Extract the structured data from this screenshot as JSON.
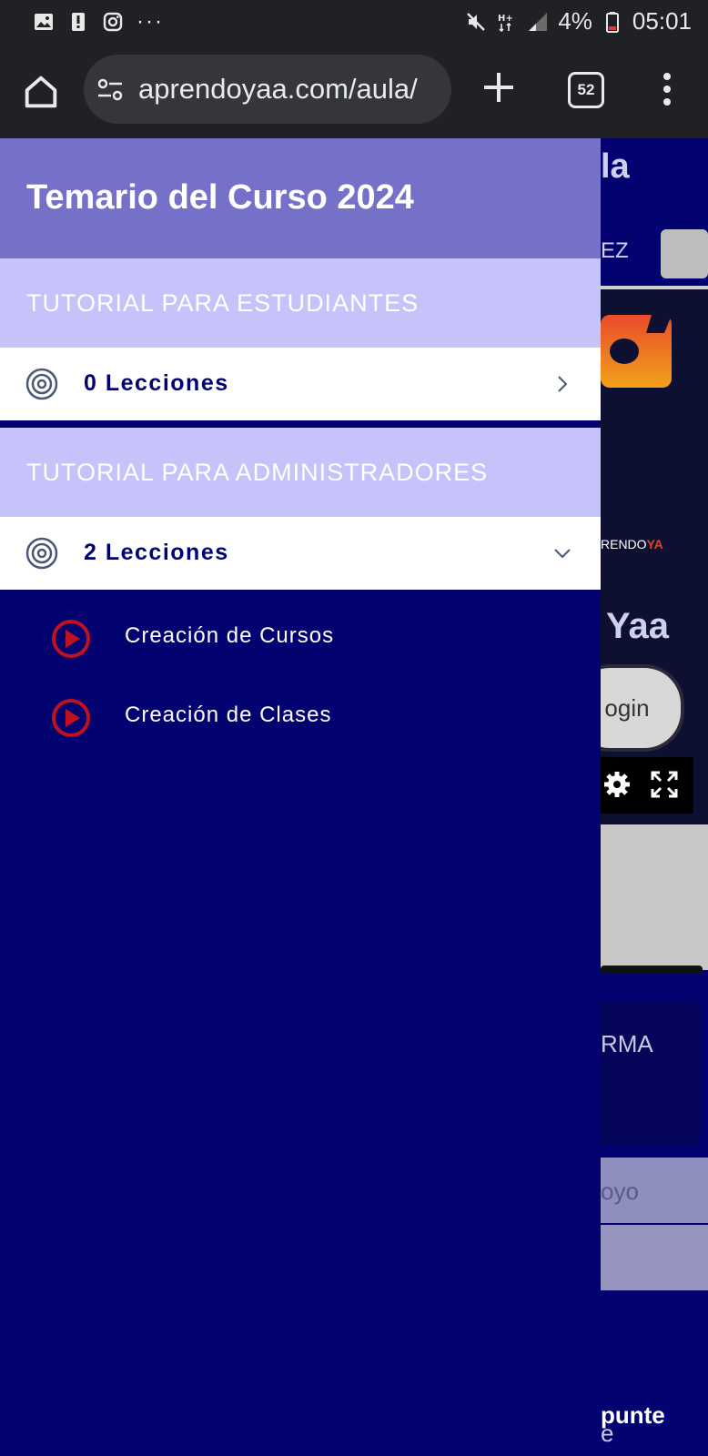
{
  "status_bar": {
    "battery": "4%",
    "time": "05:01",
    "more_dots": "···"
  },
  "browser": {
    "url": "aprendoyaa.com/aula/",
    "tab_count": "52"
  },
  "drawer": {
    "title": "Temario del Curso 2024",
    "sections": [
      {
        "heading": "TUTORIAL PARA ESTUDIANTES",
        "lessons_label": "0 Lecciones",
        "expanded": false,
        "items": []
      },
      {
        "heading": "TUTORIAL PARA ADMINISTRADORES",
        "lessons_label": "2 Lecciones",
        "expanded": true,
        "items": [
          "Creación de Cursos",
          "Creación de Clases"
        ]
      }
    ]
  },
  "background_page": {
    "title_fragment": "la",
    "name_fragment": "EZ",
    "logo_text_a": "RENDO",
    "logo_text_b": "YA",
    "brand_fragment": "Yaa",
    "login_fragment": "ogin",
    "card_fragment": "RMA",
    "apoyo_fragment": "oyo",
    "e_fragment": "e",
    "apunte_fragment": "punte"
  },
  "colors": {
    "drawer_bg": "#020270",
    "header_bg": "#7570c8",
    "section_bg": "#c6c3fb",
    "play_icon": "#c0111f"
  }
}
